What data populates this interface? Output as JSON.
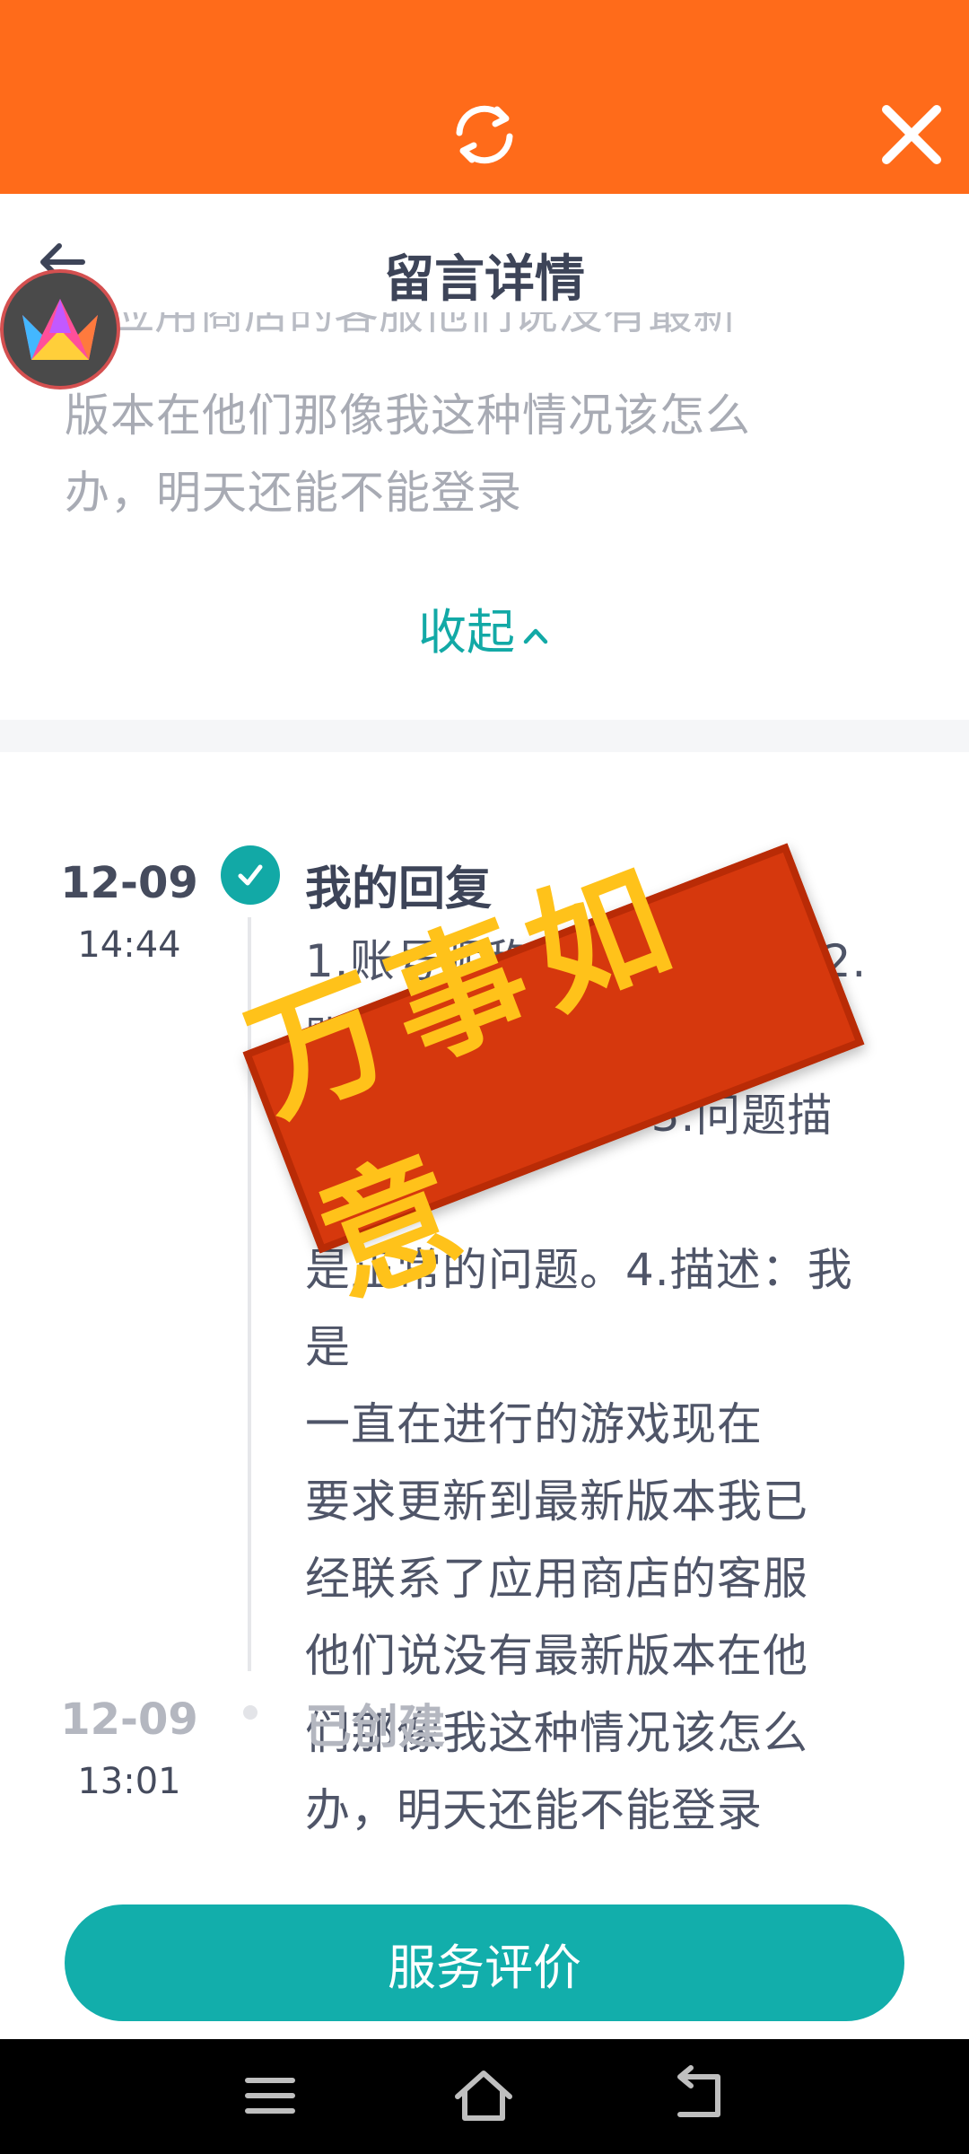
{
  "header": {
    "title": "留言详情"
  },
  "message": {
    "clipped_line": "们应用商店的客服他们说没有最新",
    "line_2": "版本在他们那像我这种情况该怎么",
    "line_3": "办，明天还能不能登录",
    "collapse_label": "收起"
  },
  "timeline": {
    "reply": {
      "date": "12-09",
      "time": "14:44",
      "title": "我的回复",
      "body_lines": [
        "1.账号昵称：刘胖刘兔子 2.账号",
        "ID：29584567 3.问题描述：",
        "是正常的问题。4.描述：我是",
        "一直在进行的游戏现在",
        "要求更新到最新版本我已",
        "经联系了应用商店的客服",
        "他们说没有最新版本在他",
        "们那像我这种情况该怎么",
        "办，明天还能不能登录"
      ]
    },
    "created": {
      "date": "12-09",
      "time": "13:01",
      "label": "已创建"
    }
  },
  "stamp_text": "万事如意",
  "service_button": "服务评价",
  "colors": {
    "accent": "#12a9a6",
    "topbar": "#ff6b1a",
    "stamp": "#d6380d"
  }
}
